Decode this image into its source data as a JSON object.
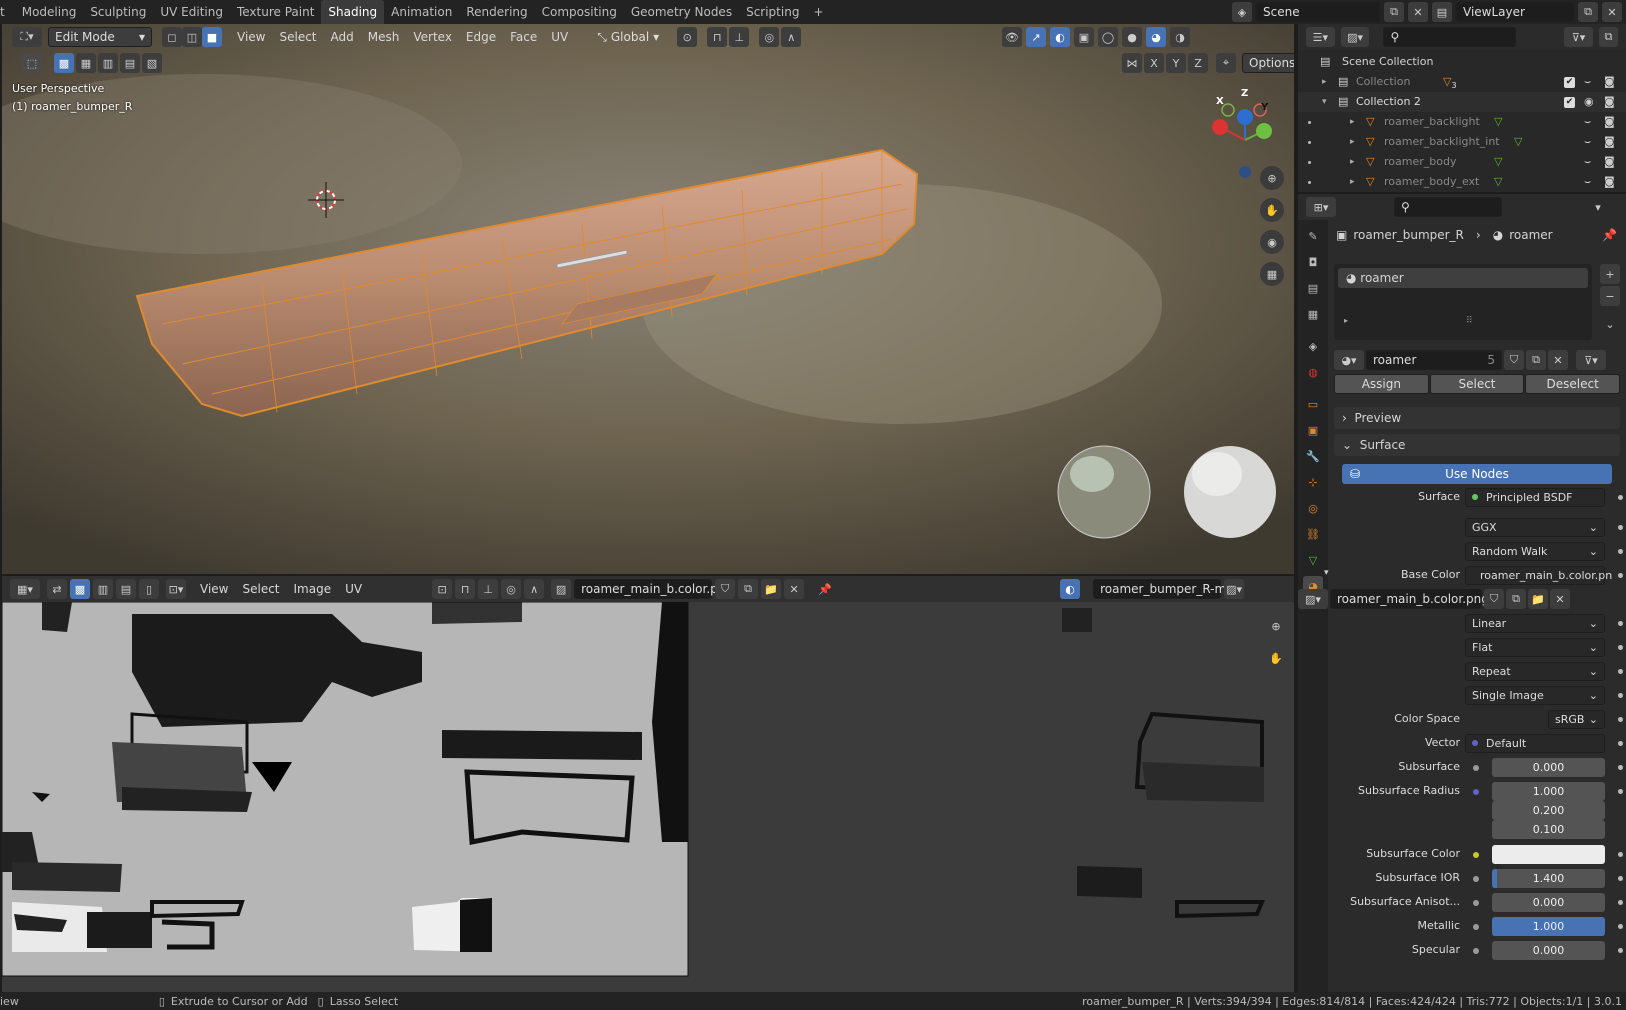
{
  "topbar": {
    "workspaces": [
      "t",
      "Modeling",
      "Sculpting",
      "UV Editing",
      "Texture Paint",
      "Shading",
      "Animation",
      "Rendering",
      "Compositing",
      "Geometry Nodes",
      "Scripting",
      "+"
    ],
    "active": "Shading",
    "scene": "Scene",
    "view_layer": "ViewLayer"
  },
  "viewport_header": {
    "mode": "Edit Mode",
    "menus": [
      "View",
      "Select",
      "Add",
      "Mesh",
      "Vertex",
      "Edge",
      "Face",
      "UV"
    ],
    "orientation": "Global",
    "options": "Options",
    "axes": [
      "X",
      "Y",
      "Z"
    ]
  },
  "viewport": {
    "line1": "User Perspective",
    "line2": "(1) roamer_bumper_R",
    "gizmo_z": "Z",
    "gizmo_y": "Y",
    "gizmo_x": "X"
  },
  "image_header": {
    "menus": [
      "View",
      "Select",
      "Image",
      "UV"
    ],
    "image_name": "roamer_main_b.color.png",
    "uvmap": "roamer_bumper_R-me..."
  },
  "outliner": {
    "scene_collection": "Scene Collection",
    "items": [
      {
        "name": "Collection",
        "dim": true
      },
      {
        "name": "Collection 2",
        "dim": false
      },
      {
        "name": "roamer_backlight",
        "dim": true
      },
      {
        "name": "roamer_backlight_int",
        "dim": true
      },
      {
        "name": "roamer_body",
        "dim": true
      },
      {
        "name": "roamer_body_ext",
        "dim": true
      }
    ],
    "collection_badge": "3"
  },
  "properties": {
    "breadcrumb_object": "roamer_bumper_R",
    "breadcrumb_material": "roamer",
    "slot": "roamer",
    "material_name": "roamer",
    "users": "5",
    "assign": "Assign",
    "select": "Select",
    "deselect": "Deselect",
    "preview": "Preview",
    "surface_panel": "Surface",
    "use_nodes": "Use Nodes",
    "rows": [
      {
        "label": "Surface",
        "value": "Principled BSDF",
        "kind": "socket"
      },
      {
        "label": "",
        "value": "GGX",
        "kind": "dd"
      },
      {
        "label": "",
        "value": "Random Walk",
        "kind": "dd"
      },
      {
        "label": "Base Color",
        "value": "roamer_main_b.color.pn",
        "kind": "socket"
      },
      {
        "label": "",
        "value": "roamer_main_b.color.png",
        "kind": "image"
      },
      {
        "label": "",
        "value": "Linear",
        "kind": "dd"
      },
      {
        "label": "",
        "value": "Flat",
        "kind": "dd"
      },
      {
        "label": "",
        "value": "Repeat",
        "kind": "dd"
      },
      {
        "label": "",
        "value": "Single Image",
        "kind": "dd"
      },
      {
        "label": "Color Space",
        "value": "sRGB",
        "kind": "dd"
      },
      {
        "label": "Vector",
        "value": "Default",
        "kind": "socket"
      },
      {
        "label": "Subsurface",
        "value": "0.000",
        "kind": "num"
      },
      {
        "label": "Subsurface Radius",
        "value": "1.000",
        "kind": "num"
      },
      {
        "label": "",
        "value": "0.200",
        "kind": "num"
      },
      {
        "label": "",
        "value": "0.100",
        "kind": "num"
      },
      {
        "label": "Subsurface Color",
        "value": "",
        "kind": "color"
      },
      {
        "label": "Subsurface IOR",
        "value": "1.400",
        "kind": "num",
        "fill": 0.04
      },
      {
        "label": "Subsurface Anisot...",
        "value": "0.000",
        "kind": "num"
      },
      {
        "label": "Metallic",
        "value": "1.000",
        "kind": "num",
        "fill": 1
      },
      {
        "label": "Specular",
        "value": "0.000",
        "kind": "num"
      }
    ]
  },
  "statusbar": {
    "left": "iew",
    "hint1": "Extrude to Cursor or Add",
    "hint2": "Lasso Select",
    "stats": "roamer_bumper_R | Verts:394/394 | Edges:814/814 | Faces:424/424 | Tris:772 | Objects:1/1 | 3.0.1"
  },
  "colors": {
    "accent": "#4772b3",
    "edit_orange": "#e08a2e",
    "header": "#2b2b2b"
  }
}
